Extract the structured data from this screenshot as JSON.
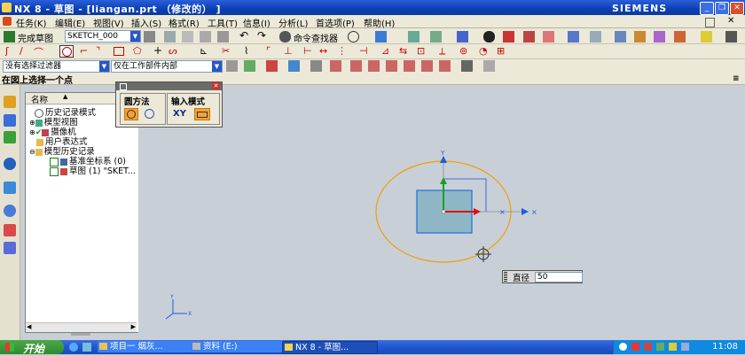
{
  "window": {
    "title": "NX 8 - 草图 - [liangan.prt （修改的）  ]",
    "brand": "SIEMENS"
  },
  "menus": [
    "任务(K)",
    "编辑(E)",
    "视图(V)",
    "插入(S)",
    "格式(R)",
    "工具(T)",
    "信息(I)",
    "分析(L)",
    "首选项(P)",
    "帮助(H)"
  ],
  "toolbar1": {
    "finish_sketch": "完成草图",
    "sketch_name": "SKETCH_000",
    "command_finder": "命令查找器"
  },
  "toolbar3": {
    "filter_value": "没有选择过滤器",
    "scope_value": "仅在工作部件内部"
  },
  "status": {
    "prompt": "在図上选择一个点"
  },
  "navigator": {
    "column_header": "名称",
    "items": [
      {
        "label": "历史记录模式"
      },
      {
        "label": "模型视图"
      },
      {
        "label": "摄像机"
      },
      {
        "label": "用户表达式"
      },
      {
        "label": "模型历史记录"
      },
      {
        "label": "基准坐标系 (0)"
      },
      {
        "label": "草图 (1) \"SKET..."
      }
    ]
  },
  "circle_dialog": {
    "method_label": "圆方法",
    "input_mode_label": "输入模式",
    "xy_label": "XY"
  },
  "diameter_input": {
    "label": "直径",
    "value": "50"
  },
  "taskbar": {
    "start_label": "开始",
    "tasks": [
      "项目一 烟灰...",
      "资料 (E:)",
      "NX 8 - 草图..."
    ],
    "clock": "11:08"
  },
  "colors": {
    "title_blue": "#0a3fb4",
    "circle_orange": "#f0a000",
    "rect_fill": "#8fb6c4",
    "rect_border": "#1f6fe0",
    "axis_green": "#1aa01a",
    "axis_red": "#e01010"
  }
}
